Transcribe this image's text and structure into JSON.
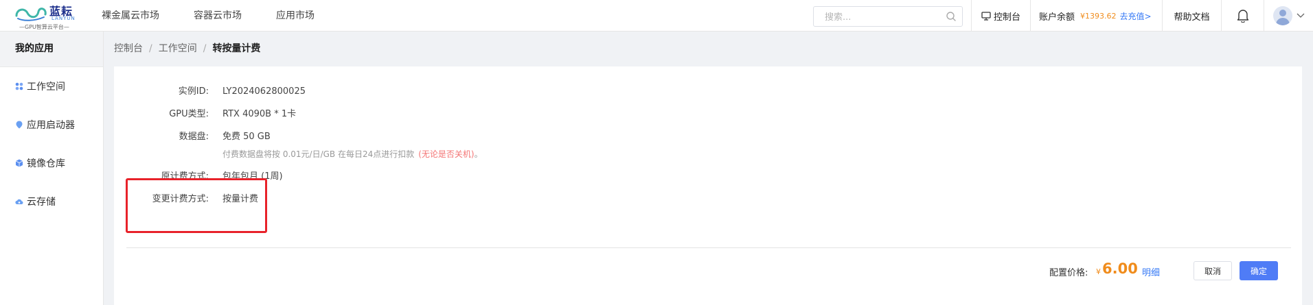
{
  "brand": {
    "name_cn": "蓝耘",
    "name_en": "LANYUN",
    "tagline": "GPU智算云平台"
  },
  "top_nav": [
    {
      "label": "裸金属云市场"
    },
    {
      "label": "容器云市场"
    },
    {
      "label": "应用市场"
    }
  ],
  "search": {
    "placeholder": "搜索...",
    "value": "",
    "icon": "search-icon"
  },
  "header": {
    "console_label": "控制台",
    "console_icon": "monitor-icon",
    "balance_label": "账户余额",
    "balance_amount": "¥1393.62",
    "recharge_label": "去充值>",
    "help_label": "帮助文档",
    "bell_icon": "bell-icon",
    "avatar_icon": "user-avatar",
    "dropdown_icon": "chevron-down-icon"
  },
  "sidebar": {
    "title": "我的应用",
    "items": [
      {
        "label": "工作空间",
        "icon": "workspace-icon"
      },
      {
        "label": "应用启动器",
        "icon": "launcher-icon"
      },
      {
        "label": "镜像仓库",
        "icon": "image-repo-icon"
      },
      {
        "label": "云存储",
        "icon": "cloud-storage-icon"
      }
    ]
  },
  "breadcrumb": [
    "控制台",
    "工作空间",
    "转按量计费"
  ],
  "form": {
    "instance_id_label": "实例ID:",
    "instance_id": "LY2024062800025",
    "gpu_type_label": "GPU类型:",
    "gpu_type": "RTX 4090B * 1卡",
    "disk_label": "数据盘:",
    "disk_value": "免费 50 GB",
    "disk_note": "付费数据盘将按 0.01元/日/GB 在每日24点进行扣款",
    "disk_note_red": "(无论是否关机)",
    "disk_note_end": "。",
    "orig_billing_label": "原计费方式:",
    "orig_billing_value": "包年包月 (1周)",
    "new_billing_label": "变更计费方式:",
    "new_billing_value": "按量计费"
  },
  "footer": {
    "price_label": "配置价格:",
    "currency": "¥",
    "price": "6.00",
    "detail_label": "明细",
    "cancel_label": "取消",
    "confirm_label": "确定"
  },
  "colors": {
    "accent": "#4f7cf6",
    "price": "#f08c1c",
    "highlight": "#e8222a",
    "link": "#3478f6"
  }
}
